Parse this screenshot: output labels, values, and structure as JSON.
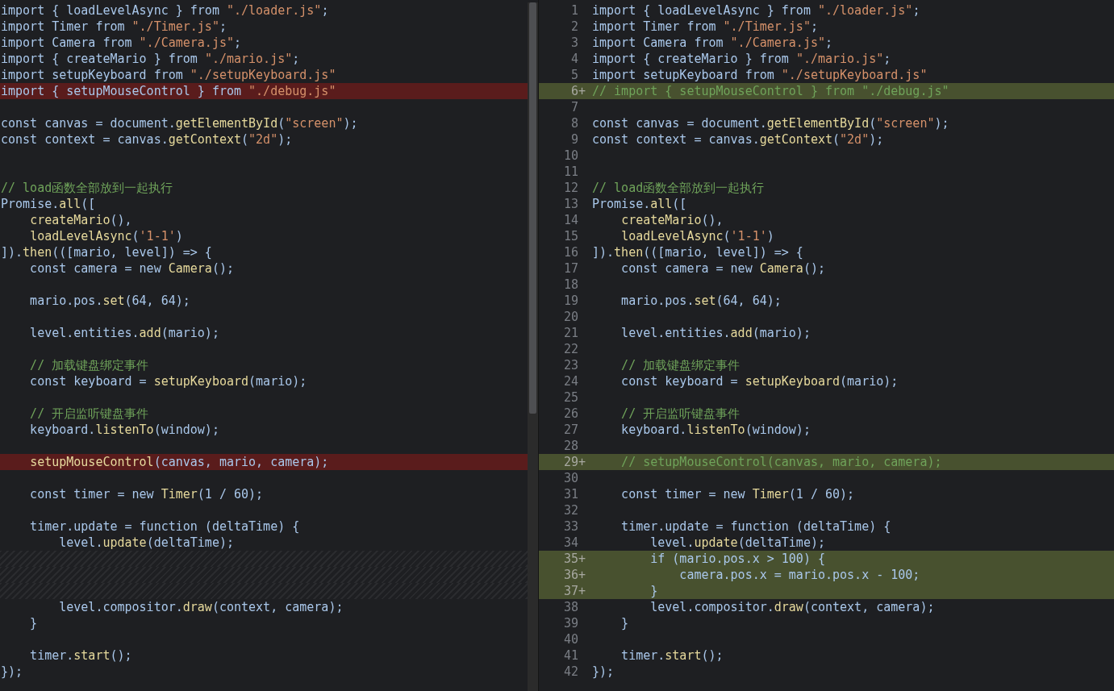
{
  "left_pane": {
    "lines": [
      {
        "removed": false,
        "kind": "code",
        "text": "import { loadLevelAsync } from \"./loader.js\";"
      },
      {
        "removed": false,
        "kind": "code",
        "text": "import Timer from \"./Timer.js\";"
      },
      {
        "removed": false,
        "kind": "code",
        "text": "import Camera from \"./Camera.js\";"
      },
      {
        "removed": false,
        "kind": "code",
        "text": "import { createMario } from \"./mario.js\";"
      },
      {
        "removed": false,
        "kind": "code",
        "text": "import setupKeyboard from \"./setupKeyboard.js\""
      },
      {
        "removed": true,
        "kind": "code",
        "text": "import { setupMouseControl } from \"./debug.js\""
      },
      {
        "kind": "blank"
      },
      {
        "removed": false,
        "kind": "code",
        "text": "const canvas = document.getElementById(\"screen\");"
      },
      {
        "removed": false,
        "kind": "code",
        "text": "const context = canvas.getContext(\"2d\");"
      },
      {
        "kind": "blank"
      },
      {
        "kind": "blank"
      },
      {
        "removed": false,
        "kind": "comment",
        "text": "// load函数全部放到一起执行"
      },
      {
        "removed": false,
        "kind": "code",
        "text": "Promise.all(["
      },
      {
        "removed": false,
        "kind": "code",
        "text": "    createMario(),"
      },
      {
        "removed": false,
        "kind": "code",
        "text": "    loadLevelAsync('1-1')"
      },
      {
        "removed": false,
        "kind": "code",
        "text": "]).then(([mario, level]) => {"
      },
      {
        "removed": false,
        "kind": "code",
        "text": "    const camera = new Camera();"
      },
      {
        "kind": "blank"
      },
      {
        "removed": false,
        "kind": "code",
        "text": "    mario.pos.set(64, 64);"
      },
      {
        "kind": "blank"
      },
      {
        "removed": false,
        "kind": "code",
        "text": "    level.entities.add(mario);"
      },
      {
        "kind": "blank"
      },
      {
        "removed": false,
        "kind": "comment",
        "text": "    // 加载键盘绑定事件"
      },
      {
        "removed": false,
        "kind": "code",
        "text": "    const keyboard = setupKeyboard(mario);"
      },
      {
        "kind": "blank"
      },
      {
        "removed": false,
        "kind": "comment",
        "text": "    // 开启监听键盘事件"
      },
      {
        "removed": false,
        "kind": "code",
        "text": "    keyboard.listenTo(window);"
      },
      {
        "kind": "blank"
      },
      {
        "removed": true,
        "kind": "code",
        "text": "    setupMouseControl(canvas, mario, camera);"
      },
      {
        "kind": "blank"
      },
      {
        "removed": false,
        "kind": "code",
        "text": "    const timer = new Timer(1 / 60);"
      },
      {
        "kind": "blank"
      },
      {
        "removed": false,
        "kind": "code",
        "text": "    timer.update = function (deltaTime) {"
      },
      {
        "removed": false,
        "kind": "code",
        "text": "        level.update(deltaTime);"
      },
      {
        "kind": "filler"
      },
      {
        "kind": "filler"
      },
      {
        "kind": "filler"
      },
      {
        "removed": false,
        "kind": "code",
        "text": "        level.compositor.draw(context, camera);"
      },
      {
        "removed": false,
        "kind": "code",
        "text": "    }"
      },
      {
        "kind": "blank"
      },
      {
        "removed": false,
        "kind": "code",
        "text": "    timer.start();"
      },
      {
        "removed": false,
        "kind": "code",
        "text": "});"
      }
    ]
  },
  "right_pane": {
    "lines": [
      {
        "number": "1",
        "added": false,
        "kind": "code",
        "text": "import { loadLevelAsync } from \"./loader.js\";"
      },
      {
        "number": "2",
        "added": false,
        "kind": "code",
        "text": "import Timer from \"./Timer.js\";"
      },
      {
        "number": "3",
        "added": false,
        "kind": "code",
        "text": "import Camera from \"./Camera.js\";"
      },
      {
        "number": "4",
        "added": false,
        "kind": "code",
        "text": "import { createMario } from \"./mario.js\";"
      },
      {
        "number": "5",
        "added": false,
        "kind": "code",
        "text": "import setupKeyboard from \"./setupKeyboard.js\""
      },
      {
        "number": "6+",
        "added": true,
        "kind": "comment",
        "text": "// import { setupMouseControl } from \"./debug.js\""
      },
      {
        "number": "7",
        "added": false
      },
      {
        "number": "8",
        "added": false,
        "kind": "code",
        "text": "const canvas = document.getElementById(\"screen\");"
      },
      {
        "number": "9",
        "added": false,
        "kind": "code",
        "text": "const context = canvas.getContext(\"2d\");"
      },
      {
        "number": "10",
        "added": false
      },
      {
        "number": "11",
        "added": false
      },
      {
        "number": "12",
        "added": false,
        "kind": "comment",
        "text": "// load函数全部放到一起执行"
      },
      {
        "number": "13",
        "added": false,
        "kind": "code",
        "text": "Promise.all(["
      },
      {
        "number": "14",
        "added": false,
        "kind": "code",
        "text": "    createMario(),"
      },
      {
        "number": "15",
        "added": false,
        "kind": "code",
        "text": "    loadLevelAsync('1-1')"
      },
      {
        "number": "16",
        "added": false,
        "kind": "code",
        "text": "]).then(([mario, level]) => {"
      },
      {
        "number": "17",
        "added": false,
        "kind": "code",
        "text": "    const camera = new Camera();"
      },
      {
        "number": "18",
        "added": false
      },
      {
        "number": "19",
        "added": false,
        "kind": "code",
        "text": "    mario.pos.set(64, 64);"
      },
      {
        "number": "20",
        "added": false
      },
      {
        "number": "21",
        "added": false,
        "kind": "code",
        "text": "    level.entities.add(mario);"
      },
      {
        "number": "22",
        "added": false
      },
      {
        "number": "23",
        "added": false,
        "kind": "comment",
        "text": "    // 加载键盘绑定事件"
      },
      {
        "number": "24",
        "added": false,
        "kind": "code",
        "text": "    const keyboard = setupKeyboard(mario);"
      },
      {
        "number": "25",
        "added": false
      },
      {
        "number": "26",
        "added": false,
        "kind": "comment",
        "text": "    // 开启监听键盘事件"
      },
      {
        "number": "27",
        "added": false,
        "kind": "code",
        "text": "    keyboard.listenTo(window);"
      },
      {
        "number": "28",
        "added": false
      },
      {
        "number": "29+",
        "added": true,
        "kind": "comment",
        "text": "    // setupMouseControl(canvas, mario, camera);"
      },
      {
        "number": "30",
        "added": false
      },
      {
        "number": "31",
        "added": false,
        "kind": "code",
        "text": "    const timer = new Timer(1 / 60);"
      },
      {
        "number": "32",
        "added": false
      },
      {
        "number": "33",
        "added": false,
        "kind": "code",
        "text": "    timer.update = function (deltaTime) {"
      },
      {
        "number": "34",
        "added": false,
        "kind": "code",
        "text": "        level.update(deltaTime);"
      },
      {
        "number": "35+",
        "added": true,
        "kind": "code",
        "text": "        if (mario.pos.x > 100) {"
      },
      {
        "number": "36+",
        "added": true,
        "kind": "code",
        "text": "            camera.pos.x = mario.pos.x - 100;"
      },
      {
        "number": "37+",
        "added": true,
        "kind": "code",
        "text": "        }"
      },
      {
        "number": "38",
        "added": false,
        "kind": "code",
        "text": "        level.compositor.draw(context, camera);"
      },
      {
        "number": "39",
        "added": false,
        "kind": "code",
        "text": "    }"
      },
      {
        "number": "40",
        "added": false
      },
      {
        "number": "41",
        "added": false,
        "kind": "code",
        "text": "    timer.start();"
      },
      {
        "number": "42",
        "added": false,
        "kind": "code",
        "text": "});"
      }
    ]
  }
}
